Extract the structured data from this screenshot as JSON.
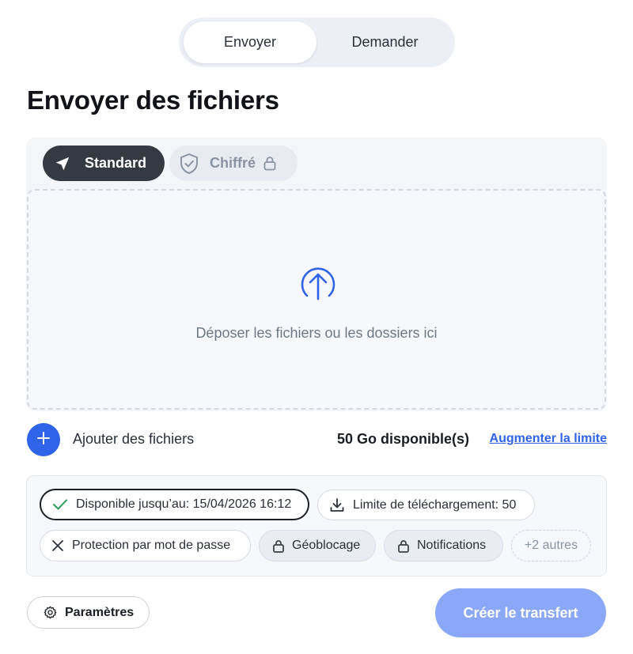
{
  "mode_toggle": {
    "tabs": [
      {
        "label": "Envoyer",
        "active": true
      },
      {
        "label": "Demander",
        "active": false
      }
    ]
  },
  "page_title": "Envoyer des fichiers",
  "transfer_types": {
    "standard": {
      "label": "Standard",
      "icon": "send-icon",
      "selected": true
    },
    "encrypted": {
      "label": "Chiffré",
      "icon": "shield-icon",
      "locked_icon": "lock-icon",
      "selected": false
    }
  },
  "dropzone": {
    "icon": "upload-icon",
    "text": "Déposer les fichiers ou les dossiers ici"
  },
  "add_files": {
    "label": "Ajouter des fichiers",
    "storage": "50 Go disponible(s)",
    "increase_link": "Augmenter la limite"
  },
  "options": {
    "availability": {
      "label": "Disponible jusqu’au: 15/04/2026 16:12",
      "icon": "check-icon"
    },
    "download_limit": {
      "label": "Limite de téléchargement: 50",
      "icon": "download-icon"
    },
    "password": {
      "label": "Protection par mot de passe",
      "icon": "close-icon"
    },
    "geoblocking": {
      "label": "Géoblocage",
      "icon": "lock-icon"
    },
    "notifications": {
      "label": "Notifications",
      "icon": "lock-icon"
    },
    "more": {
      "label": "+2 autres"
    }
  },
  "footer": {
    "settings_label": "Paramètres",
    "create_label": "Créer le transfert"
  },
  "colors": {
    "accent": "#2f63e8",
    "create_button_disabled": "#8aa8f7",
    "dark_pill": "#353a42",
    "check_green": "#2e9e5b"
  }
}
